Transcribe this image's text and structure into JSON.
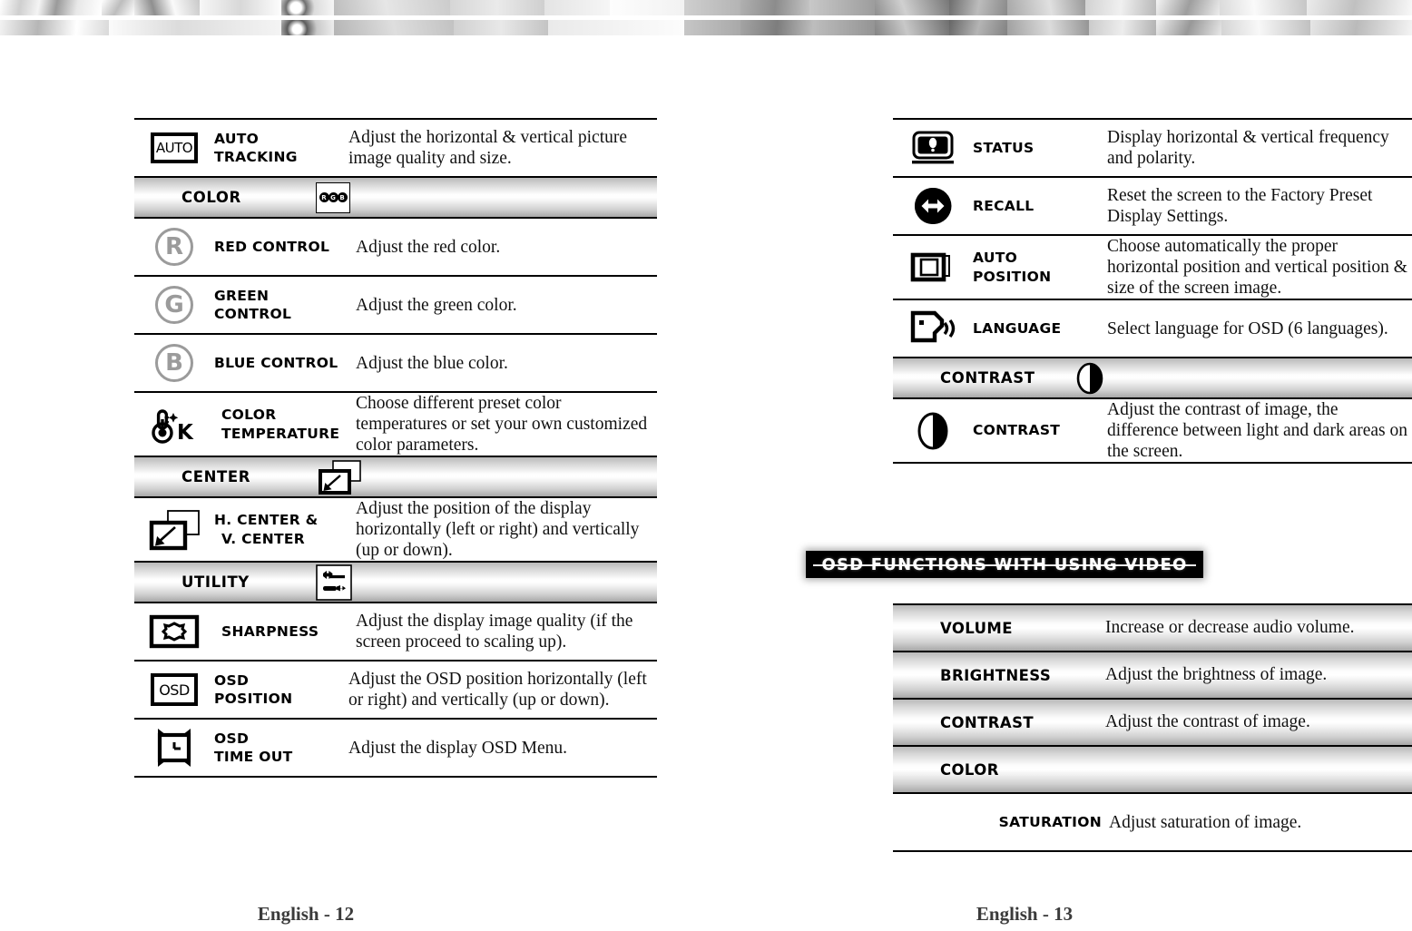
{
  "document": {
    "type": "monitor-user-manual-osd-reference"
  },
  "left_page": {
    "footer": "English - 12",
    "rows": [
      {
        "kind": "item",
        "icon": "auto-box-icon",
        "name_lines": [
          "AUTO",
          "TRACKING"
        ],
        "description": "Adjust the horizontal & vertical picture image quality and size."
      },
      {
        "kind": "section",
        "label": "COLOR",
        "icon": "rgb-box-icon"
      },
      {
        "kind": "item",
        "icon": "circled-r-icon",
        "name_lines": [
          "RED CONTROL"
        ],
        "description": "Adjust the red color."
      },
      {
        "kind": "item",
        "icon": "circled-g-icon",
        "name_lines": [
          "GREEN",
          "CONTROL"
        ],
        "description": "Adjust the green color."
      },
      {
        "kind": "item",
        "icon": "circled-b-icon",
        "name_lines": [
          "BLUE CONTROL"
        ],
        "description": "Adjust the blue color."
      },
      {
        "kind": "item",
        "icon": "thermometer-kelvin-icon",
        "name_lines": [
          "COLOR",
          "TEMPERATURE"
        ],
        "description": "Choose different preset color temperatures or set your own customized color parameters."
      },
      {
        "kind": "section",
        "label": "CENTER",
        "icon": "center-arrow-icon"
      },
      {
        "kind": "item",
        "icon": "center-arrow-icon",
        "name_lines": [
          "H. CENTER &",
          "V. CENTER"
        ],
        "description": "Adjust the position of the display horizontally (left or right) and vertically (up or down)."
      },
      {
        "kind": "section",
        "label": "UTILITY",
        "icon": "wrench-screwdriver-icon"
      },
      {
        "kind": "item",
        "icon": "sharpness-icon",
        "name_lines": [
          "SHARPNESS"
        ],
        "description": "Adjust the display image quality (if the screen proceed to scaling up)."
      },
      {
        "kind": "item",
        "icon": "osd-box-icon",
        "name_lines": [
          "OSD",
          "POSITION"
        ],
        "description": "Adjust the OSD position horizontally (left or right) and vertically (up or down)."
      },
      {
        "kind": "item",
        "icon": "alarm-clock-icon",
        "name_lines": [
          "OSD",
          "TIME OUT"
        ],
        "description": "Adjust the display OSD Menu."
      }
    ]
  },
  "right_page": {
    "footer": "English - 13",
    "banner": "OSD FUNCTIONS WITH USING VIDEO",
    "rows": [
      {
        "kind": "item",
        "icon": "status-monitor-icon",
        "name_lines": [
          "STATUS"
        ],
        "description": "Display horizontal & vertical frequency and polarity."
      },
      {
        "kind": "item",
        "icon": "recall-arrows-icon",
        "name_lines": [
          "RECALL"
        ],
        "description": "Reset the screen to the Factory Preset Display Settings."
      },
      {
        "kind": "item",
        "icon": "auto-position-icon",
        "name_lines": [
          "AUTO",
          "POSITION"
        ],
        "description": "Choose automatically the proper horizontal position and vertical position & size of the screen image."
      },
      {
        "kind": "item",
        "icon": "language-speaker-icon",
        "name_lines": [
          "LANGUAGE"
        ],
        "description": "Select language for OSD (6 languages)."
      },
      {
        "kind": "section",
        "label": "CONTRAST",
        "icon": "contrast-circle-icon"
      },
      {
        "kind": "item",
        "icon": "contrast-circle-icon",
        "name_lines": [
          "CONTRAST"
        ],
        "description": "Adjust the contrast of image, the difference between light and dark areas on the screen."
      }
    ],
    "video_rows": [
      {
        "label": "VOLUME",
        "description": "Increase or decrease audio volume."
      },
      {
        "label": "BRIGHTNESS",
        "description": "Adjust the brightness of image."
      },
      {
        "label": "CONTRAST",
        "description": "Adjust the contrast of image."
      },
      {
        "label": "COLOR",
        "description": ""
      }
    ],
    "video_subrow": {
      "label": "SATURATION",
      "description": "Adjust saturation of image."
    }
  },
  "colors": {
    "text": "#000000",
    "banner_bg": "#000000",
    "banner_text": "#ffffff",
    "gradient_light": "#ffffff",
    "gradient_dark": "#a8a8a8",
    "circled_letter": "#9b9b9b"
  }
}
